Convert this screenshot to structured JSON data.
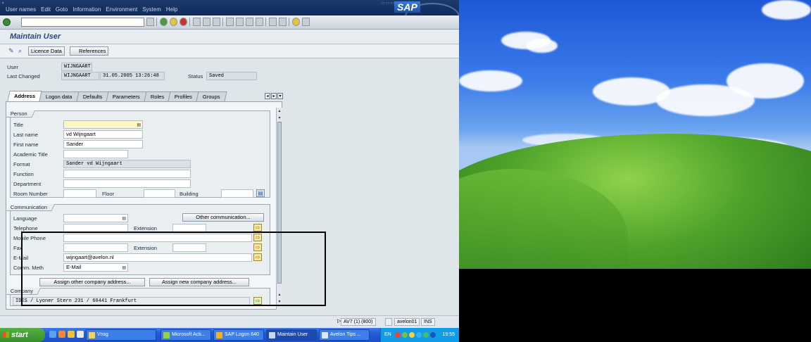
{
  "menu": [
    "User names",
    "Edit",
    "Goto",
    "Information",
    "Environment",
    "System",
    "Help"
  ],
  "brand": "SAP",
  "title": "Maintain User",
  "app_toolbar": {
    "licence_label": "Licence Data",
    "references_label": "References"
  },
  "header": {
    "user_label": "User",
    "user_value": "WIJNGAART",
    "changed_label": "Last Changed",
    "changed_by": "WIJNGAART",
    "changed_date": "31.05.2005 13:26:48",
    "status_label": "Status",
    "status_value": "Saved"
  },
  "tabs": [
    "Address",
    "Logon data",
    "Defaults",
    "Parameters",
    "Roles",
    "Profiles",
    "Groups"
  ],
  "person": {
    "title": "Person",
    "title_label": "Title",
    "title_value": "",
    "lastname_label": "Last name",
    "lastname_value": "vd Wijngaart",
    "firstname_label": "First name",
    "firstname_value": "Sander",
    "academic_label": "Academic Title",
    "academic_value": "",
    "format_label": "Format",
    "format_value": "Sander vd Wijngaart",
    "function_label": "Function",
    "function_value": "",
    "department_label": "Department",
    "department_value": "",
    "room_label": "Room Number",
    "floor_label": "Floor",
    "building_label": "Building"
  },
  "communication": {
    "title": "Communication",
    "language_label": "Language",
    "other_button": "Other communication...",
    "telephone_label": "Telephone",
    "extension_label": "Extension",
    "mobile_label": "Mobile Phone",
    "fax_label": "Fax",
    "fax_extension_label": "Extension",
    "email_label": "E-Mail",
    "email_value": "wijngaart@avelon.nl",
    "comm_label": "Comm. Meth",
    "comm_value": "E-Mail"
  },
  "company_buttons": {
    "assign_other": "Assign other company address...",
    "assign_new": "Assign new company address..."
  },
  "company": {
    "title": "Company",
    "address": "IDES / Lyoner Stern 231 / 60441 Frankfurt"
  },
  "status_bar": {
    "system": "AV7 (1) (800)",
    "user": "avelon01",
    "mode": "INS"
  },
  "taskbar": {
    "start_label": "start",
    "tasks": [
      "Vnsg",
      "Microsoft Acti...",
      "SAP Logon 640",
      "Maintain User",
      "Avelon Tips ..."
    ],
    "lang": "EN",
    "clock": "19:55"
  },
  "colors": {
    "sap_title": "#2a4a7c",
    "taskbar": "#245bd6",
    "start": "#368f2c"
  }
}
